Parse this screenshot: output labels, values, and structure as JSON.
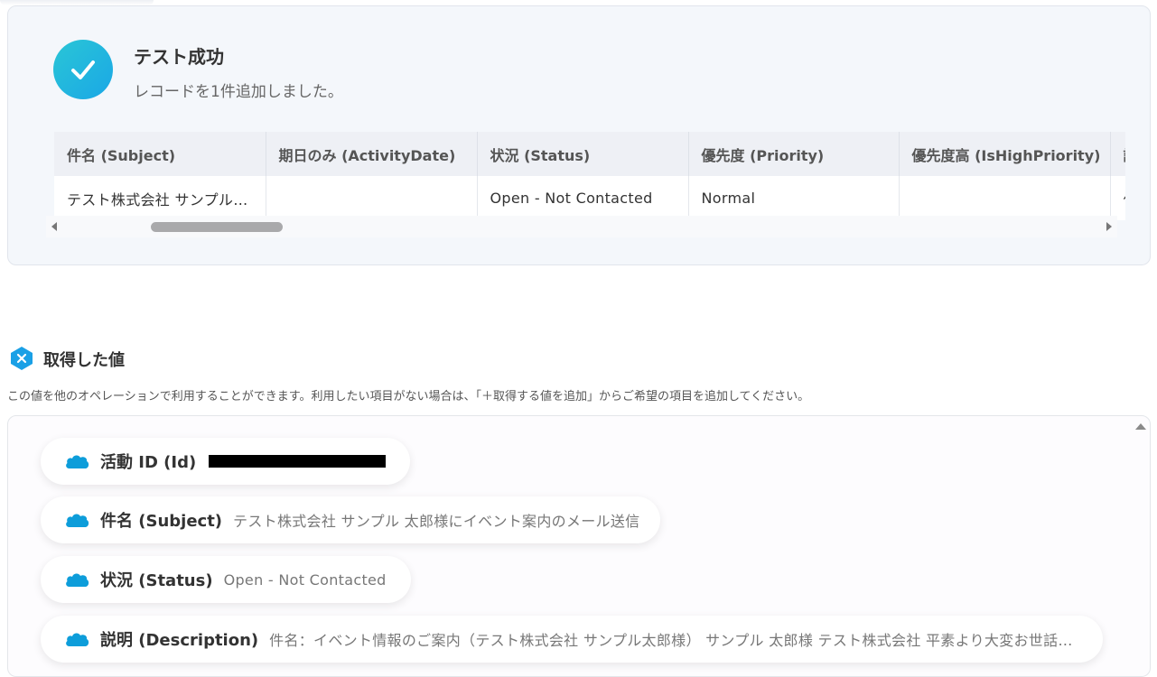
{
  "success": {
    "title": "テスト成功",
    "subtitle": "レコードを1件追加しました。"
  },
  "table": {
    "headers": [
      "件名 (Subject)",
      "期日のみ (ActivityDate)",
      "状況 (Status)",
      "優先度 (Priority)",
      "優先度高 (IsHighPriority)",
      "説"
    ],
    "row": [
      "テスト株式会社 サンプル 太郎様にイベント案内のメール送信",
      "",
      "Open - Not Contacted",
      "Normal",
      "",
      "件"
    ]
  },
  "acquired": {
    "title": "取得した値",
    "description": "この値を他のオペレーションで利用することができます。利用したい項目がない場合は、「＋取得する値を追加」からご希望の項目を追加してください。",
    "items": [
      {
        "label": "活動 ID (Id)",
        "value": ""
      },
      {
        "label": "件名 (Subject)",
        "value": "テスト株式会社 サンプル 太郎様にイベント案内のメール送信"
      },
      {
        "label": "状況 (Status)",
        "value": "Open - Not Contacted"
      },
      {
        "label": "説明 (Description)",
        "value": "件名：イベント情報のご案内（テスト株式会社 サンプル太郎様） サンプル 太郎様 テスト株式会社 平素より大変お世話にな..."
      }
    ]
  },
  "colors": {
    "accent": "#1aa7e6",
    "salesforce_blue": "#0d9dda"
  },
  "icons": {
    "success": "check-icon",
    "section": "variable-x-icon",
    "item": "salesforce-cloud-icon"
  }
}
